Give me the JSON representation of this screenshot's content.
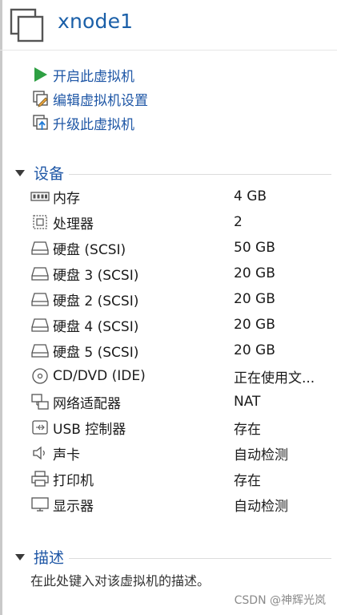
{
  "header": {
    "vm_name": "xnode1"
  },
  "actions": [
    {
      "label": "开启此虚拟机",
      "icon": "play-icon"
    },
    {
      "label": "编辑虚拟机设置",
      "icon": "edit-settings-icon"
    },
    {
      "label": "升级此虚拟机",
      "icon": "upgrade-icon"
    }
  ],
  "devices_section": {
    "title": "设备"
  },
  "devices": [
    {
      "name": "内存",
      "value": "4 GB",
      "icon": "memory-icon"
    },
    {
      "name": "处理器",
      "value": "2",
      "icon": "processor-icon"
    },
    {
      "name": "硬盘 (SCSI)",
      "value": "50 GB",
      "icon": "harddisk-icon"
    },
    {
      "name": "硬盘 3 (SCSI)",
      "value": "20 GB",
      "icon": "harddisk-icon"
    },
    {
      "name": "硬盘 2 (SCSI)",
      "value": "20 GB",
      "icon": "harddisk-icon"
    },
    {
      "name": "硬盘 4 (SCSI)",
      "value": "20 GB",
      "icon": "harddisk-icon"
    },
    {
      "name": "硬盘 5 (SCSI)",
      "value": "20 GB",
      "icon": "harddisk-icon"
    },
    {
      "name": "CD/DVD (IDE)",
      "value": "正在使用文...",
      "icon": "cd-dvd-icon"
    },
    {
      "name": "网络适配器",
      "value": "NAT",
      "icon": "network-adapter-icon"
    },
    {
      "name": "USB 控制器",
      "value": "存在",
      "icon": "usb-icon"
    },
    {
      "name": "声卡",
      "value": "自动检测",
      "icon": "speaker-icon"
    },
    {
      "name": "打印机",
      "value": "存在",
      "icon": "printer-icon"
    },
    {
      "name": "显示器",
      "value": "自动检测",
      "icon": "monitor-icon"
    }
  ],
  "description_section": {
    "title": "描述",
    "placeholder": "在此处键入对该虚拟机的描述。"
  },
  "watermark": "CSDN @神辉光岚",
  "colors": {
    "link": "#1f57a6",
    "title": "#1a5fa8",
    "play": "#2ea043"
  }
}
